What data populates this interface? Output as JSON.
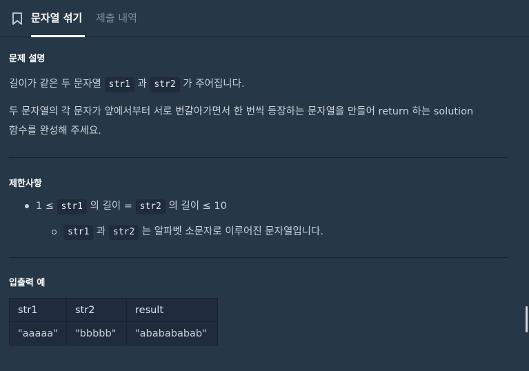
{
  "tabs": {
    "active": "문자열 섞기",
    "inactive": "제출 내역"
  },
  "description": {
    "heading": "문제 설명",
    "line1_pre": "길이가 같은 두 문자열",
    "line1_code1": "str1",
    "line1_mid": "과",
    "line1_code2": "str2",
    "line1_post": "가 주어집니다.",
    "line2": "두 문자열의 각 문자가 앞에서부터 서로 번갈아가면서 한 번씩 등장하는 문자열을 만들어 return 하는 solution",
    "line3": "함수를 완성해 주세요."
  },
  "constraints": {
    "heading": "제한사항",
    "item1_pre": "1 ≤",
    "item1_code1": "str1",
    "item1_mid1": "의 길이 =",
    "item1_code2": "str2",
    "item1_post": "의 길이 ≤ 10",
    "sub_code1": "str1",
    "sub_mid": "과",
    "sub_code2": "str2",
    "sub_post": "는 알파벳 소문자로 이루어진 문자열입니다."
  },
  "examples": {
    "heading": "입출력 예",
    "columns": [
      "str1",
      "str2",
      "result"
    ],
    "rows": [
      [
        "\"aaaaa\"",
        "\"bbbbb\"",
        "\"ababababab\""
      ]
    ]
  }
}
